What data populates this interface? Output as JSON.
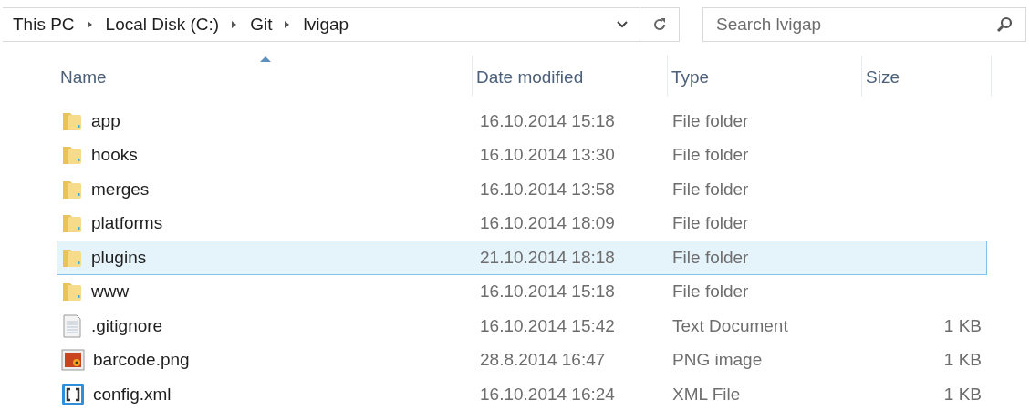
{
  "address_bar": {
    "breadcrumbs": [
      "This PC",
      "Local Disk (C:)",
      "Git",
      "lvigap"
    ]
  },
  "search": {
    "placeholder": "Search lvigap"
  },
  "table": {
    "columns": [
      {
        "label": "Name",
        "sorted": true
      },
      {
        "label": "Date modified",
        "sorted": false
      },
      {
        "label": "Type",
        "sorted": false
      },
      {
        "label": "Size",
        "sorted": false
      }
    ],
    "rows": [
      {
        "kind": "folder",
        "name": "app",
        "date": "16.10.2014 15:18",
        "type": "File folder",
        "selected": false
      },
      {
        "kind": "folder",
        "name": "hooks",
        "date": "16.10.2014 13:30",
        "type": "File folder",
        "selected": false
      },
      {
        "kind": "folder",
        "name": "merges",
        "date": "16.10.2014 13:58",
        "type": "File folder",
        "selected": false
      },
      {
        "kind": "folder",
        "name": "platforms",
        "date": "16.10.2014 18:09",
        "type": "File folder",
        "selected": false
      },
      {
        "kind": "folder",
        "name": "plugins",
        "date": "21.10.2014 18:18",
        "type": "File folder",
        "selected": true
      },
      {
        "kind": "folder",
        "name": "www",
        "date": "16.10.2014 15:18",
        "type": "File folder",
        "selected": false
      },
      {
        "kind": "text",
        "name": ".gitignore",
        "date": "16.10.2014 15:42",
        "type": "Text Document",
        "size": "1 KB",
        "selected": false
      },
      {
        "kind": "image",
        "name": "barcode.png",
        "date": "28.8.2014 16:47",
        "type": "PNG image",
        "size": "1 KB",
        "selected": false
      },
      {
        "kind": "xml",
        "name": "config.xml",
        "date": "16.10.2014 16:24",
        "type": "XML File",
        "size": "1 KB",
        "selected": false
      }
    ]
  }
}
